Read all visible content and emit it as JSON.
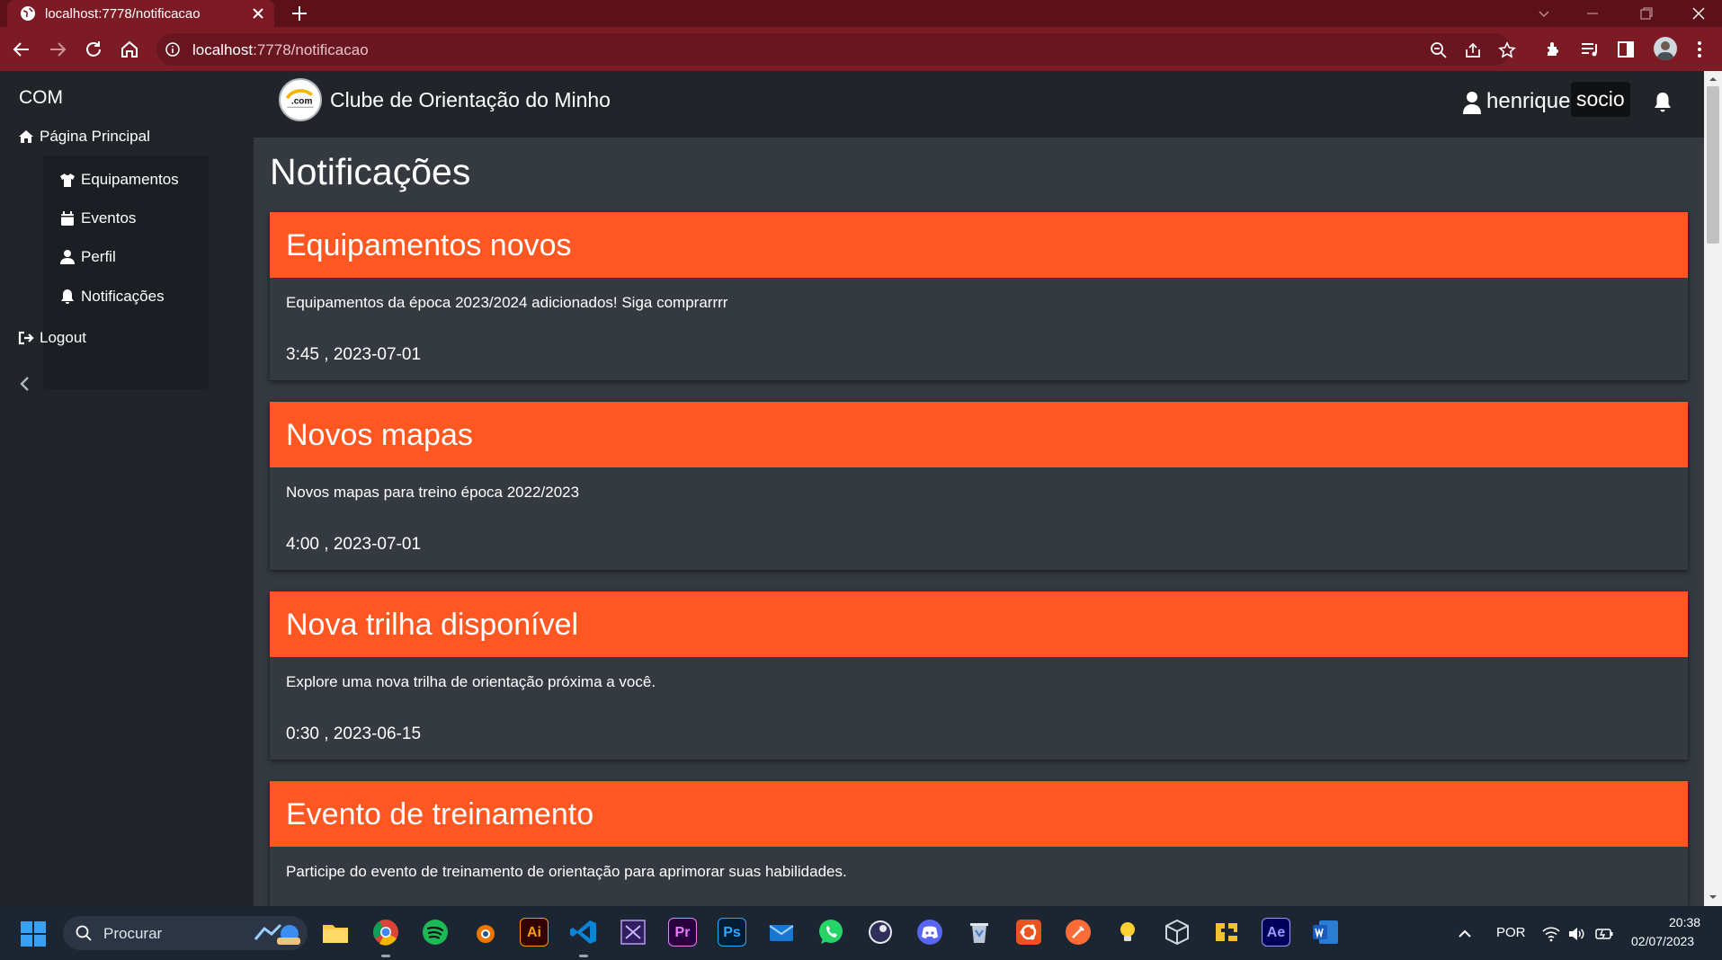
{
  "browser": {
    "tab_title": "localhost:7778/notificacao",
    "url_host": "localhost",
    "url_path": ":7778/notificacao"
  },
  "sidebar": {
    "brand": "COM",
    "home": "Página Principal",
    "items": [
      {
        "label": "Equipamentos",
        "icon": "shirt-icon"
      },
      {
        "label": "Eventos",
        "icon": "calendar-icon"
      },
      {
        "label": "Perfil",
        "icon": "user-icon"
      },
      {
        "label": "Notificações",
        "icon": "bell-icon"
      }
    ],
    "logout": "Logout"
  },
  "header": {
    "logo_text": ".com",
    "club_name": "Clube de Orientação do Minho",
    "username": "henrique",
    "role": "socio"
  },
  "main": {
    "title": "Notificações",
    "notifications": [
      {
        "title": "Equipamentos novos",
        "body": "Equipamentos da época 2023/2024 adicionados! Siga comprarrrr",
        "time": "3:45 , 2023-07-01"
      },
      {
        "title": "Novos mapas",
        "body": "Novos mapas para treino época 2022/2023",
        "time": "4:00 , 2023-07-01"
      },
      {
        "title": "Nova trilha disponível",
        "body": "Explore uma nova trilha de orientação próxima a você.",
        "time": "0:30 , 2023-06-15"
      },
      {
        "title": "Evento de treinamento",
        "body": "Participe do evento de treinamento de orientação para aprimorar suas habilidades.",
        "time": ""
      }
    ]
  },
  "colors": {
    "accent": "#ff5722",
    "sidebar_bg": "#212529",
    "content_bg": "#343a40",
    "chrome": "#7d1b24"
  },
  "taskbar": {
    "search_placeholder": "Procurar",
    "language": "POR",
    "time": "20:38",
    "date": "02/07/2023",
    "apps": [
      "file-explorer",
      "chrome",
      "spotify",
      "blender",
      "illustrator",
      "vscode",
      "visual-studio",
      "premiere",
      "photoshop",
      "mail",
      "whatsapp",
      "obs",
      "discord",
      "recycle-bin",
      "ubuntu",
      "postman",
      "idea",
      "3d-box",
      "gamemaker",
      "after-effects",
      "word"
    ]
  }
}
